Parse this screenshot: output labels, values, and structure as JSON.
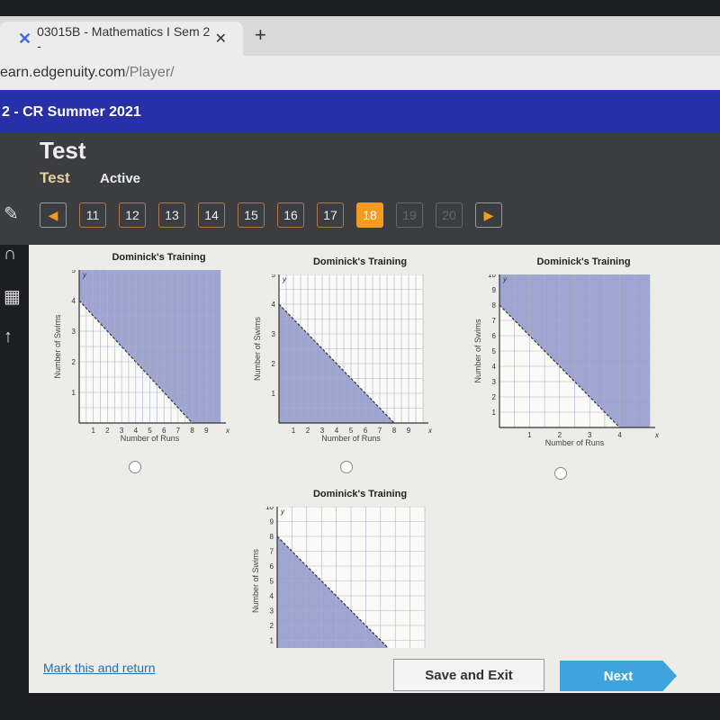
{
  "browser": {
    "tab_title": "03015B - Mathematics I Sem 2 -",
    "url_host": "earn.edgenuity.com",
    "url_path": "/Player/"
  },
  "banner": {
    "course": "2 - CR Summer 2021"
  },
  "header": {
    "title": "Test",
    "subtitle": "Test",
    "status": "Active"
  },
  "question_nav": {
    "prev": "◀",
    "next": "▶",
    "items": [
      {
        "label": "11",
        "state": "done"
      },
      {
        "label": "12",
        "state": "done"
      },
      {
        "label": "13",
        "state": "done"
      },
      {
        "label": "14",
        "state": "done"
      },
      {
        "label": "15",
        "state": "done"
      },
      {
        "label": "16",
        "state": "done"
      },
      {
        "label": "17",
        "state": "done"
      },
      {
        "label": "18",
        "state": "current"
      },
      {
        "label": "19",
        "state": "disabled"
      },
      {
        "label": "20",
        "state": "disabled"
      }
    ]
  },
  "sidebar": {
    "icons": [
      "pencil-icon",
      "headphones-icon",
      "calculator-icon",
      "arrow-up-icon"
    ]
  },
  "chart_data": [
    {
      "type": "area",
      "title": "Dominick's Training",
      "xlabel": "Number of Runs",
      "ylabel": "Number of Swims",
      "xlim": [
        0,
        10
      ],
      "ylim": [
        0,
        5
      ],
      "xticks": [
        1,
        2,
        3,
        4,
        5,
        6,
        7,
        8,
        9
      ],
      "yticks": [
        1,
        2,
        3,
        4,
        5
      ],
      "boundary": [
        [
          0,
          4
        ],
        [
          8,
          0
        ]
      ],
      "line_style": "dashed",
      "shading": "above",
      "grid": true
    },
    {
      "type": "area",
      "title": "Dominick's Training",
      "xlabel": "Number of Runs",
      "ylabel": "Number of Swims",
      "xlim": [
        0,
        10
      ],
      "ylim": [
        0,
        5
      ],
      "xticks": [
        1,
        2,
        3,
        4,
        5,
        6,
        7,
        8,
        9
      ],
      "yticks": [
        1,
        2,
        3,
        4,
        5
      ],
      "boundary": [
        [
          0,
          4
        ],
        [
          8,
          0
        ]
      ],
      "line_style": "dashed",
      "shading": "below",
      "grid": true
    },
    {
      "type": "area",
      "title": "Dominick's Training",
      "xlabel": "Number of Runs",
      "ylabel": "Number of Swims",
      "xlim": [
        0,
        5
      ],
      "ylim": [
        0,
        10
      ],
      "xticks": [
        1,
        2,
        3,
        4
      ],
      "yticks": [
        1,
        2,
        3,
        4,
        5,
        6,
        7,
        8,
        9,
        10
      ],
      "boundary": [
        [
          0,
          8
        ],
        [
          4,
          0
        ]
      ],
      "line_style": "dashed",
      "shading": "above",
      "grid": true
    },
    {
      "type": "area",
      "title": "Dominick's Training",
      "xlabel": "",
      "ylabel": "Number of Swims",
      "xlim": [
        0,
        5
      ],
      "ylim": [
        0,
        10
      ],
      "xticks": [],
      "yticks": [
        1,
        2,
        3,
        4,
        5,
        6,
        7,
        8,
        9,
        10
      ],
      "boundary": [
        [
          0,
          8
        ],
        [
          4,
          0
        ]
      ],
      "line_style": "dashed",
      "shading": "below",
      "grid": true
    }
  ],
  "colors": {
    "shade": "#7f88c4",
    "banner": "#2730a6",
    "current": "#f59a23",
    "next": "#3ea4dc"
  },
  "footer": {
    "mark": "Mark this and return",
    "save": "Save and Exit",
    "next": "Next"
  }
}
